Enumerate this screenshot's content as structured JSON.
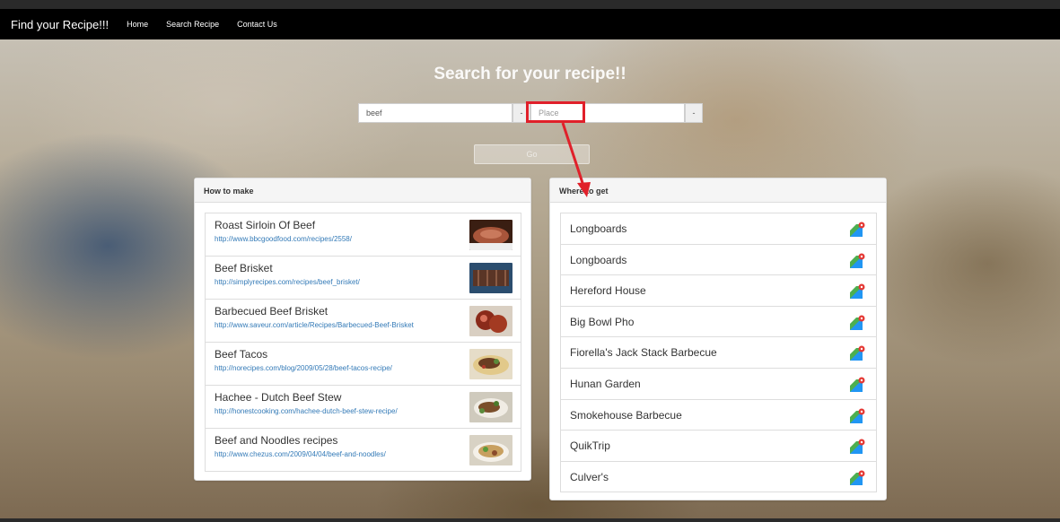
{
  "navbar": {
    "brand": "Find your Recipe!!!",
    "links": [
      "Home",
      "Search Recipe",
      "Contact Us"
    ]
  },
  "hero": {
    "title": "Search for your recipe!!"
  },
  "search": {
    "ingredient_value": "beef",
    "place_placeholder": "Place",
    "addon_left": "-",
    "addon_right": "-",
    "go_label": "Go"
  },
  "recipes_panel": {
    "heading": "How to make",
    "items": [
      {
        "title": "Roast Sirloin Of Beef",
        "url": "http://www.bbcgoodfood.com/recipes/2558/"
      },
      {
        "title": "Beef Brisket",
        "url": "http://simplyrecipes.com/recipes/beef_brisket/"
      },
      {
        "title": "Barbecued Beef Brisket",
        "url": "http://www.saveur.com/article/Recipes/Barbecued-Beef-Brisket"
      },
      {
        "title": "Beef Tacos",
        "url": "http://norecipes.com/blog/2009/05/28/beef-tacos-recipe/"
      },
      {
        "title": "Hachee - Dutch Beef Stew",
        "url": "http://honestcooking.com/hachee-dutch-beef-stew-recipe/"
      },
      {
        "title": "Beef and Noodles recipes",
        "url": "http://www.chezus.com/2009/04/04/beef-and-noodles/"
      }
    ]
  },
  "places_panel": {
    "heading": "Where to get",
    "items": [
      "Longboards",
      "Longboards",
      "Hereford House",
      "Big Bowl Pho",
      "Fiorella's Jack Stack Barbecue",
      "Hunan Garden",
      "Smokehouse Barbecue",
      "QuikTrip",
      "Culver's"
    ]
  },
  "colors": {
    "annotation": "#e0202a",
    "link": "#337ab7",
    "navbar": "#000000"
  }
}
